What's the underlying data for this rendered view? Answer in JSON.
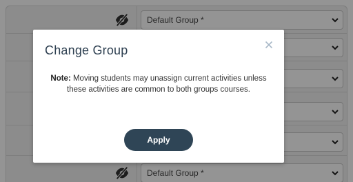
{
  "background_table": {
    "rows": [
      {
        "group_select_value": "Default Group *"
      },
      {
        "group_select_value": ""
      },
      {
        "group_select_value": ""
      },
      {
        "group_select_value": ""
      },
      {
        "group_select_value": ""
      },
      {
        "group_select_value": "Default Group *"
      }
    ]
  },
  "modal": {
    "title": "Change Group",
    "close_icon": "close-icon",
    "note_label": "Note:",
    "note_text": " Moving students may unassign current activities unless these activities are common to both groups courses.",
    "apply_label": "Apply"
  },
  "colors": {
    "primary_button": "#2f4556",
    "title_text": "#2f4152",
    "overlay": "rgba(0,0,0,0.42)"
  }
}
